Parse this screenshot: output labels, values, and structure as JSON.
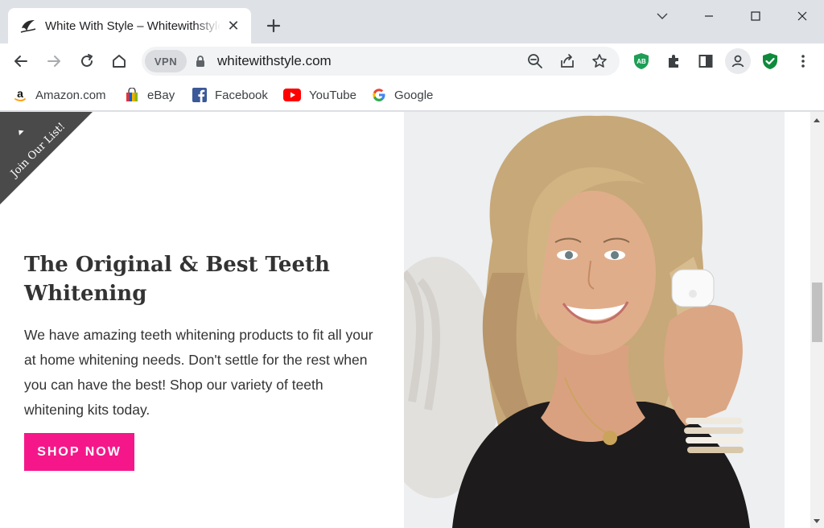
{
  "browser": {
    "tab": {
      "title": "White With Style – Whitewithstyle.com",
      "close_glyph": "✕"
    },
    "new_tab_glyph": "+",
    "vpn_label": "VPN",
    "url": "whitewithstyle.com",
    "extension_badge": "AB"
  },
  "bookmarks": [
    {
      "label": "Amazon.com",
      "icon": "amazon-icon"
    },
    {
      "label": "eBay",
      "icon": "ebay-icon"
    },
    {
      "label": "Facebook",
      "icon": "facebook-icon"
    },
    {
      "label": "YouTube",
      "icon": "youtube-icon"
    },
    {
      "label": "Google",
      "icon": "google-icon"
    }
  ],
  "page": {
    "ribbon_label": "Join Our List!",
    "hero": {
      "title": "The Original & Best Teeth Whitening",
      "body": "We have amazing teeth whitening products to fit all your at home whitening needs. Don't settle for the rest when you can have the best! Shop our variety of teeth whitening kits today.",
      "cta_label": "SHOP NOW"
    }
  },
  "colors": {
    "accent_pink": "#f5178a",
    "ribbon_gray": "#4a4a4a",
    "text_dark": "#333333"
  }
}
